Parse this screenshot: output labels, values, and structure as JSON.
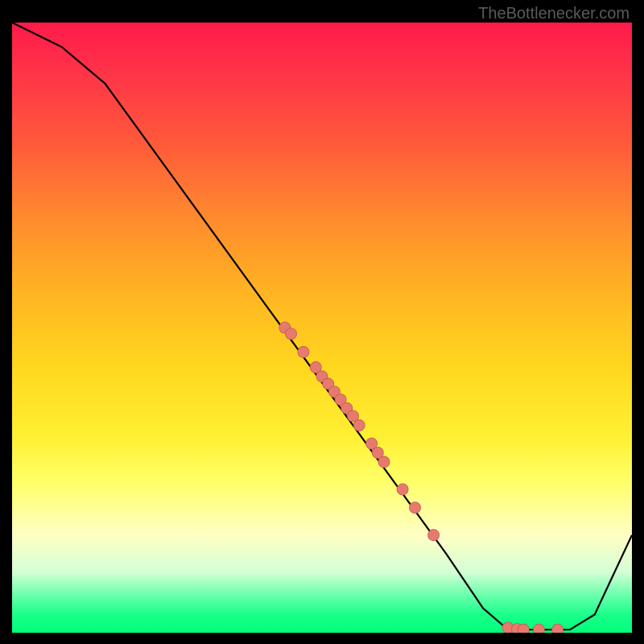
{
  "watermark": "TheBottlenecker.com",
  "chart_data": {
    "type": "line",
    "title": "",
    "xlabel": "",
    "ylabel": "",
    "xlim": [
      0,
      100
    ],
    "ylim": [
      0,
      100
    ],
    "curve": [
      {
        "x": 0,
        "y": 100
      },
      {
        "x": 8,
        "y": 96
      },
      {
        "x": 15,
        "y": 90
      },
      {
        "x": 40,
        "y": 55
      },
      {
        "x": 70,
        "y": 13
      },
      {
        "x": 76,
        "y": 4
      },
      {
        "x": 80,
        "y": 0.5
      },
      {
        "x": 90,
        "y": 0.5
      },
      {
        "x": 94,
        "y": 3
      },
      {
        "x": 100,
        "y": 16
      }
    ],
    "scatter": [
      {
        "x": 44,
        "y": 50
      },
      {
        "x": 45,
        "y": 49
      },
      {
        "x": 47,
        "y": 46
      },
      {
        "x": 49,
        "y": 43.5
      },
      {
        "x": 50,
        "y": 42
      },
      {
        "x": 51,
        "y": 40.8
      },
      {
        "x": 52,
        "y": 39.5
      },
      {
        "x": 53,
        "y": 38.2
      },
      {
        "x": 54,
        "y": 36.8
      },
      {
        "x": 55,
        "y": 35.5
      },
      {
        "x": 56,
        "y": 34
      },
      {
        "x": 58,
        "y": 31
      },
      {
        "x": 59,
        "y": 29.5
      },
      {
        "x": 60,
        "y": 28
      },
      {
        "x": 63,
        "y": 23.5
      },
      {
        "x": 65,
        "y": 20.5
      },
      {
        "x": 68,
        "y": 16
      },
      {
        "x": 80,
        "y": 0.8
      },
      {
        "x": 81.5,
        "y": 0.6
      },
      {
        "x": 82.5,
        "y": 0.5
      },
      {
        "x": 85,
        "y": 0.5
      },
      {
        "x": 88,
        "y": 0.5
      }
    ],
    "colors": {
      "curve": "#000000",
      "dots": "#e77a6f"
    }
  }
}
